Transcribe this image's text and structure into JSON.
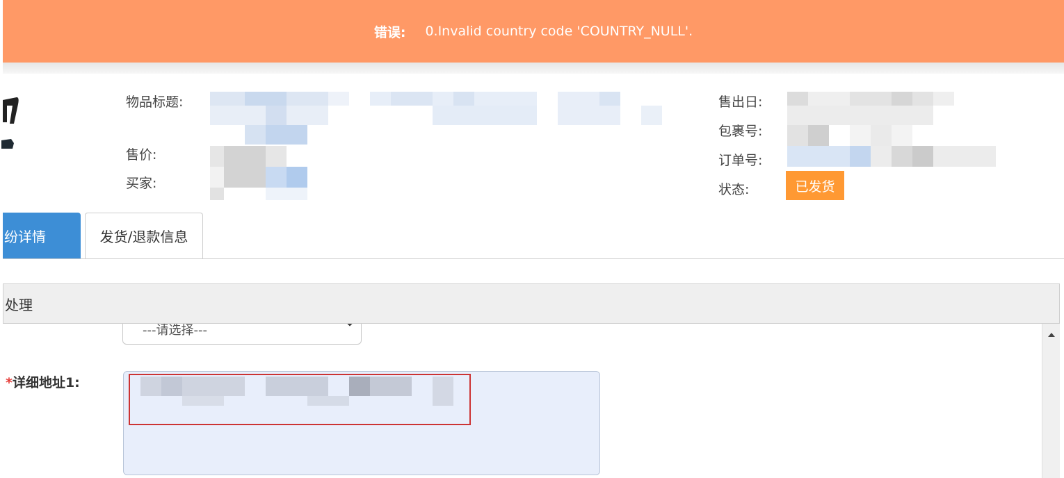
{
  "banner": {
    "label": "错误:",
    "message": "0.Invalid country code 'COUNTRY_NULL'.",
    "color": "#ff9966"
  },
  "product_info": {
    "title_label": "物品标题:",
    "price_label": "售价:",
    "buyer_label": "买家:",
    "sold_date_label": "售出日:",
    "package_label": "包裹号:",
    "order_label": "订单号:",
    "status_label": "状态:",
    "status_value": "已发货",
    "status_color": "#ff9933"
  },
  "tabs": [
    {
      "label": "纷详情",
      "active": true
    },
    {
      "label": "发货/退款信息",
      "active": false
    }
  ],
  "panel": {
    "title": "处理"
  },
  "form": {
    "select_placeholder": "---请选择---",
    "address1_required_mark": "*",
    "address1_label": "详细地址1:"
  },
  "icons": {
    "select_chevron": "chevron-down-icon",
    "scroll_up": "scroll-up-arrow-icon"
  }
}
